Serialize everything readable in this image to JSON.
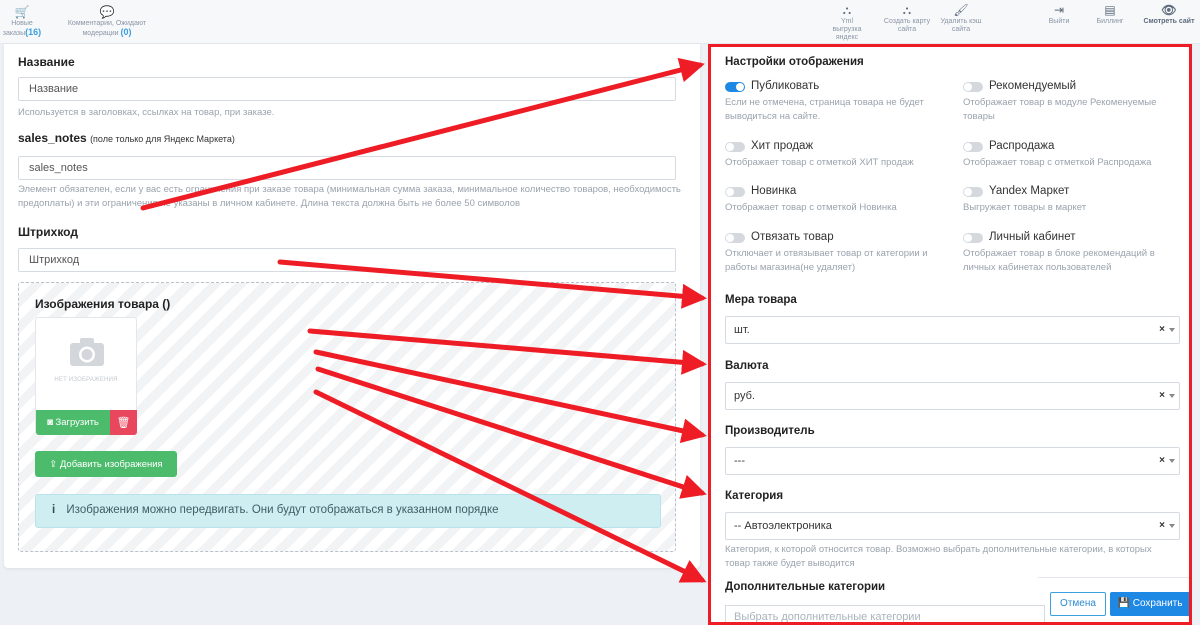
{
  "topbar": {
    "new_orders_label": "Новые заказы",
    "new_orders_count": "(16)",
    "comments_label": "Комментарии, Ожидают модерации",
    "comments_count": "(0)",
    "yml_label": "Yml выгрузка яндекс",
    "sitemap_label": "Создать карту сайта",
    "cache_label": "Удалить кэш сайта",
    "logout_label": "Выйти",
    "billing_label": "Биллинг",
    "view_site_label": "Смотреть сайт"
  },
  "form": {
    "name_label": "Название",
    "name_placeholder": "Название",
    "name_help": "Используется в заголовках, ссылках на товар, при заказе.",
    "sales_notes_label": "sales_notes",
    "sales_notes_note": "(поле только для Яндекс Маркета)",
    "sales_notes_placeholder": "sales_notes",
    "sales_notes_help": "Элемент обязателен, если у вас есть ограничения при заказе товара (минимальная сумма заказа, минимальное количество товаров, необходимость предоплаты) и эти ограничения не указаны в личном кабинете. Длина текста должна быть не более 50 символов",
    "barcode_label": "Штрихкод",
    "barcode_placeholder": "Штрихкод"
  },
  "images": {
    "title": "Изображения товара ()",
    "no_image": "НЕТ ИЗОБРАЖЕНИЯ",
    "upload_label": "Загрузить",
    "add_label": "Добавить изображения",
    "info_icon": "i",
    "info_text": "Изображения можно передвигать. Они будут отображаться в указанном порядке"
  },
  "display_settings": {
    "title": "Настройки отображения",
    "toggles": [
      {
        "label": "Публиковать",
        "on": true,
        "desc": "Если не отмечена, страница товара не будет выводиться на сайте."
      },
      {
        "label": "Рекомендуемый",
        "on": false,
        "desc": "Отображает товар в модуле Рекоменуемые товары"
      },
      {
        "label": "Хит продаж",
        "on": false,
        "desc": "Отображает товар с отметкой ХИТ продаж"
      },
      {
        "label": "Распродажа",
        "on": false,
        "desc": "Отображает товар с отметкой Распродажа"
      },
      {
        "label": "Новинка",
        "on": false,
        "desc": "Отображает товар с отметкой Новинка"
      },
      {
        "label": "Yandex Маркет",
        "on": false,
        "desc": "Выгружает товары в маркет"
      },
      {
        "label": "Отвязать товар",
        "on": false,
        "desc": "Отключает и отвязывает товар от категории и работы магазина(не удаляет)"
      },
      {
        "label": "Личный кабинет",
        "on": false,
        "desc": "Отображает товар в блоке рекомендаций в личных кабинетах пользователей"
      }
    ]
  },
  "measure": {
    "label": "Мера товара",
    "value": "шт."
  },
  "currency": {
    "label": "Валюта",
    "value": "руб."
  },
  "manufacturer": {
    "label": "Производитель",
    "value": "---"
  },
  "category": {
    "label": "Категория",
    "value": "-- Автоэлектроника",
    "help": "Категория, к которой относится товар. Возможно выбрать дополнительные категории, в которых товар также будет выводится"
  },
  "extra_categories": {
    "label": "Дополнительные категории",
    "placeholder": "Выбрать дополнительные категории"
  },
  "footer": {
    "cancel_label": "Отмена",
    "save_label": "Сохранить"
  },
  "clear_mark": "×",
  "colors": {
    "annotation": "#ee1c25",
    "primary": "#1e88e5",
    "success": "#4cbb6c",
    "danger": "#e9475e"
  }
}
